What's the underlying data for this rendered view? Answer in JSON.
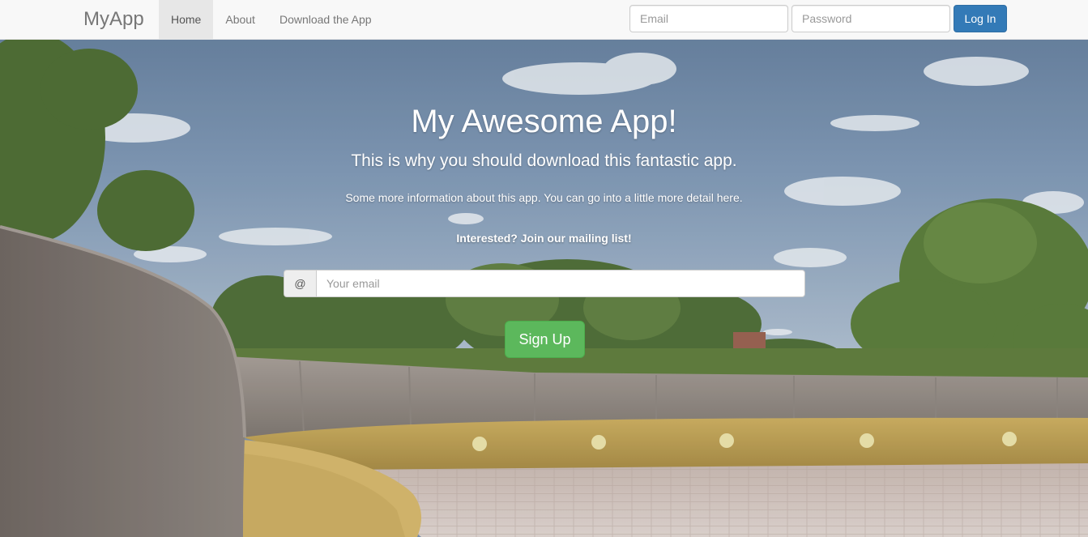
{
  "navbar": {
    "brand": "MyApp",
    "items": [
      {
        "label": "Home",
        "active": true
      },
      {
        "label": "About",
        "active": false
      },
      {
        "label": "Download the App",
        "active": false
      }
    ],
    "login": {
      "email_placeholder": "Email",
      "password_placeholder": "Password",
      "button_label": "Log In"
    }
  },
  "hero": {
    "title": "My Awesome App!",
    "lead": "This is why you should download this fantastic app.",
    "info": "Some more information about this app. You can go into a little more detail here.",
    "mailing_prompt": "Interested? Join our mailing list!",
    "email_addon": "@",
    "email_placeholder": "Your email",
    "signup_label": "Sign Up"
  },
  "colors": {
    "primary": "#337ab7",
    "success": "#5cb85c",
    "navbar_bg": "#f8f8f8"
  }
}
